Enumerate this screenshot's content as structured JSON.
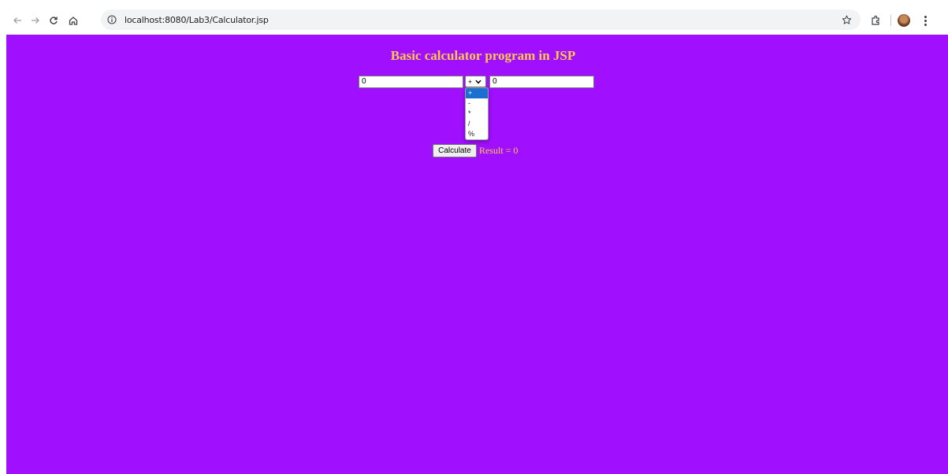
{
  "browser": {
    "url": "localhost:8080/Lab3/Calculator.jsp"
  },
  "page": {
    "title": "Basic calculator program in JSP",
    "first_value": "0",
    "second_value": "0",
    "operator_selected": "+",
    "operator_options": [
      "+",
      "-",
      "*",
      "/",
      "%"
    ],
    "calculate_label": "Calculate",
    "result_text": "Result = 0"
  },
  "colors": {
    "page_background": "#a010ff",
    "title_color": "#ffc94a",
    "selected_option": "#1a6fd1"
  }
}
